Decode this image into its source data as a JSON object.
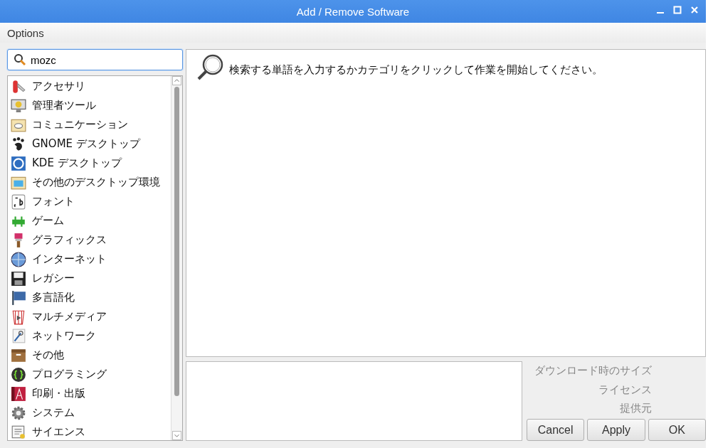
{
  "window": {
    "title": "Add / Remove Software"
  },
  "menu": [
    "Options"
  ],
  "search": {
    "value": "mozc"
  },
  "categories": [
    {
      "label": "アクセサリ"
    },
    {
      "label": "管理者ツール"
    },
    {
      "label": "コミュニケーション"
    },
    {
      "label": "GNOME デスクトップ"
    },
    {
      "label": "KDE デスクトップ"
    },
    {
      "label": "その他のデスクトップ環境"
    },
    {
      "label": "フォント"
    },
    {
      "label": "ゲーム"
    },
    {
      "label": "グラフィックス"
    },
    {
      "label": "インターネット"
    },
    {
      "label": "レガシー"
    },
    {
      "label": "多言語化"
    },
    {
      "label": "マルチメディア"
    },
    {
      "label": "ネットワーク"
    },
    {
      "label": "その他"
    },
    {
      "label": "プログラミング"
    },
    {
      "label": "印刷・出版"
    },
    {
      "label": "システム"
    },
    {
      "label": "サイエンス"
    }
  ],
  "results": {
    "message": "検索する単語を入力するかカテゴリをクリックして作業を開始してください。"
  },
  "details": {
    "labels": [
      "ダウンロード時のサイズ",
      "ライセンス",
      "提供元"
    ]
  },
  "buttons": [
    "Cancel",
    "Apply",
    "OK"
  ]
}
